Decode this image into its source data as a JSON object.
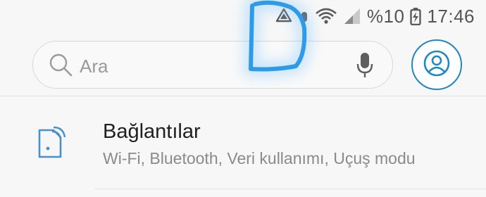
{
  "status_bar": {
    "battery_percent": "%10",
    "time": "17:46",
    "icons": [
      "recycle-icon",
      "alarm-icon",
      "wifi-icon",
      "signal-icon",
      "battery-charging-icon"
    ]
  },
  "search": {
    "placeholder": "Ara"
  },
  "settings": {
    "items": [
      {
        "title": "Bağlantılar",
        "subtitle": "Wi-Fi, Bluetooth, Veri kullanımı, Uçuş modu",
        "icon": "connections-icon"
      }
    ]
  },
  "colors": {
    "accent": "#1f87c4",
    "icon_blue": "#4a90c8",
    "scribble": "#2f9be8",
    "background": "#f7f7f7"
  }
}
